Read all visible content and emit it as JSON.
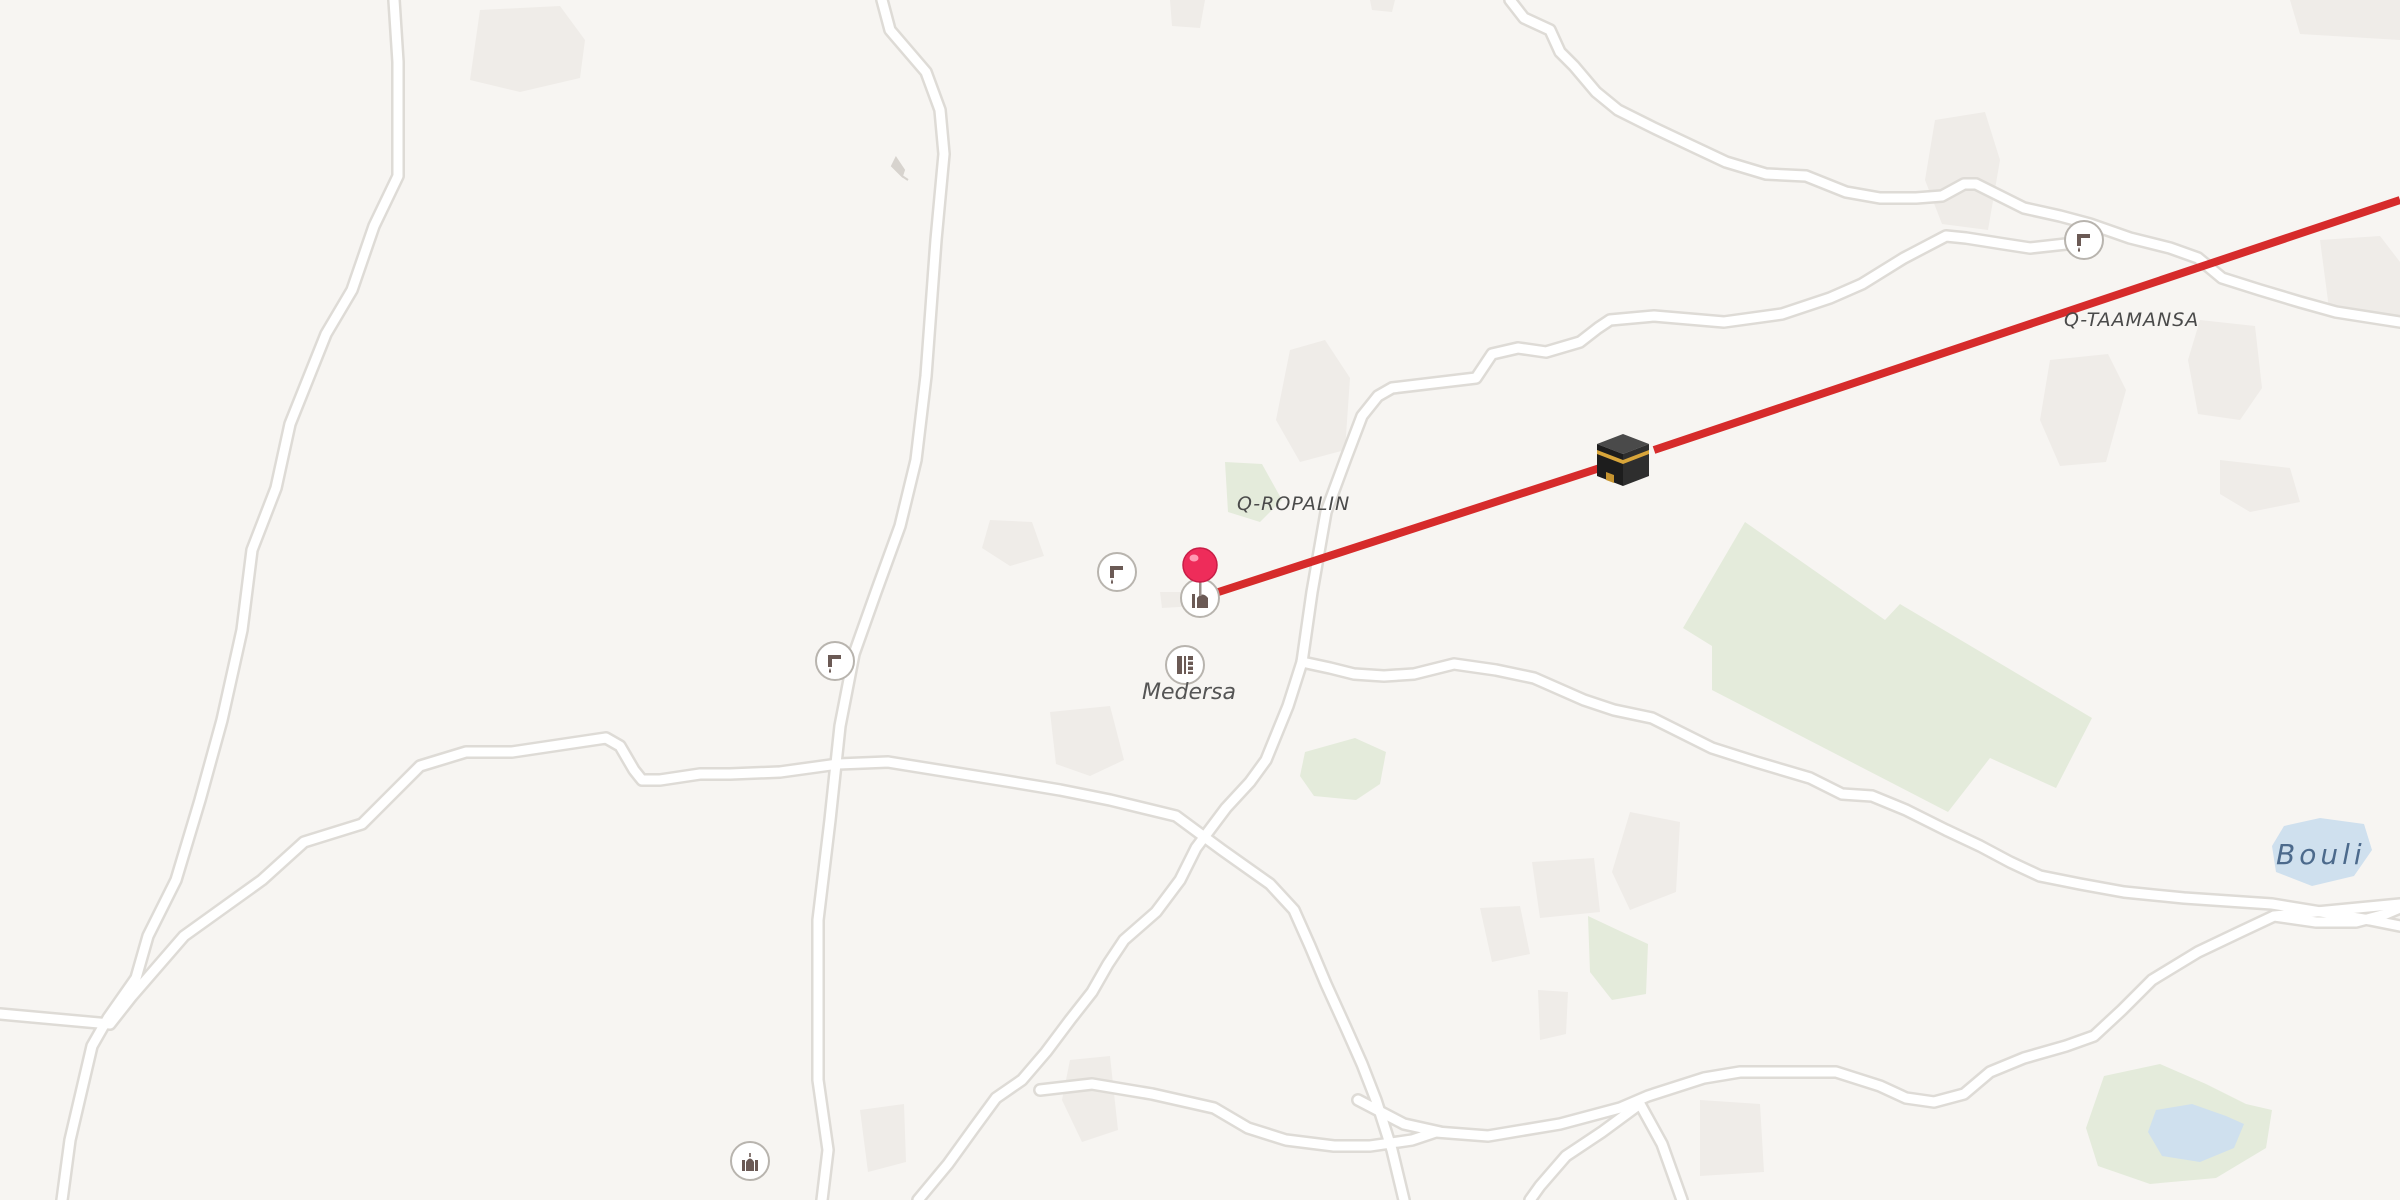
{
  "map": {
    "colors": {
      "background": "#f7f5f2",
      "road": "#ffffff",
      "road_casing": "#dedbd6",
      "vegetation": "#e4ebdb",
      "building": "#efece8",
      "water": "#cfe0ee",
      "route": "#d62b2b",
      "pin": "#ee2c5a",
      "poi_icon": "#6b5a55"
    },
    "labels": {
      "q_ropalin": "Q-ROPALIN",
      "q_taamansa": "Q-TAAMANSA",
      "medersa": "Medersa",
      "bouli": "Bouli"
    },
    "icons": {
      "water_tap": "water-tap-icon",
      "school": "school-icon",
      "mosque": "mosque-icon",
      "destination": "kaaba-icon",
      "pin": "map-pin-icon"
    }
  }
}
